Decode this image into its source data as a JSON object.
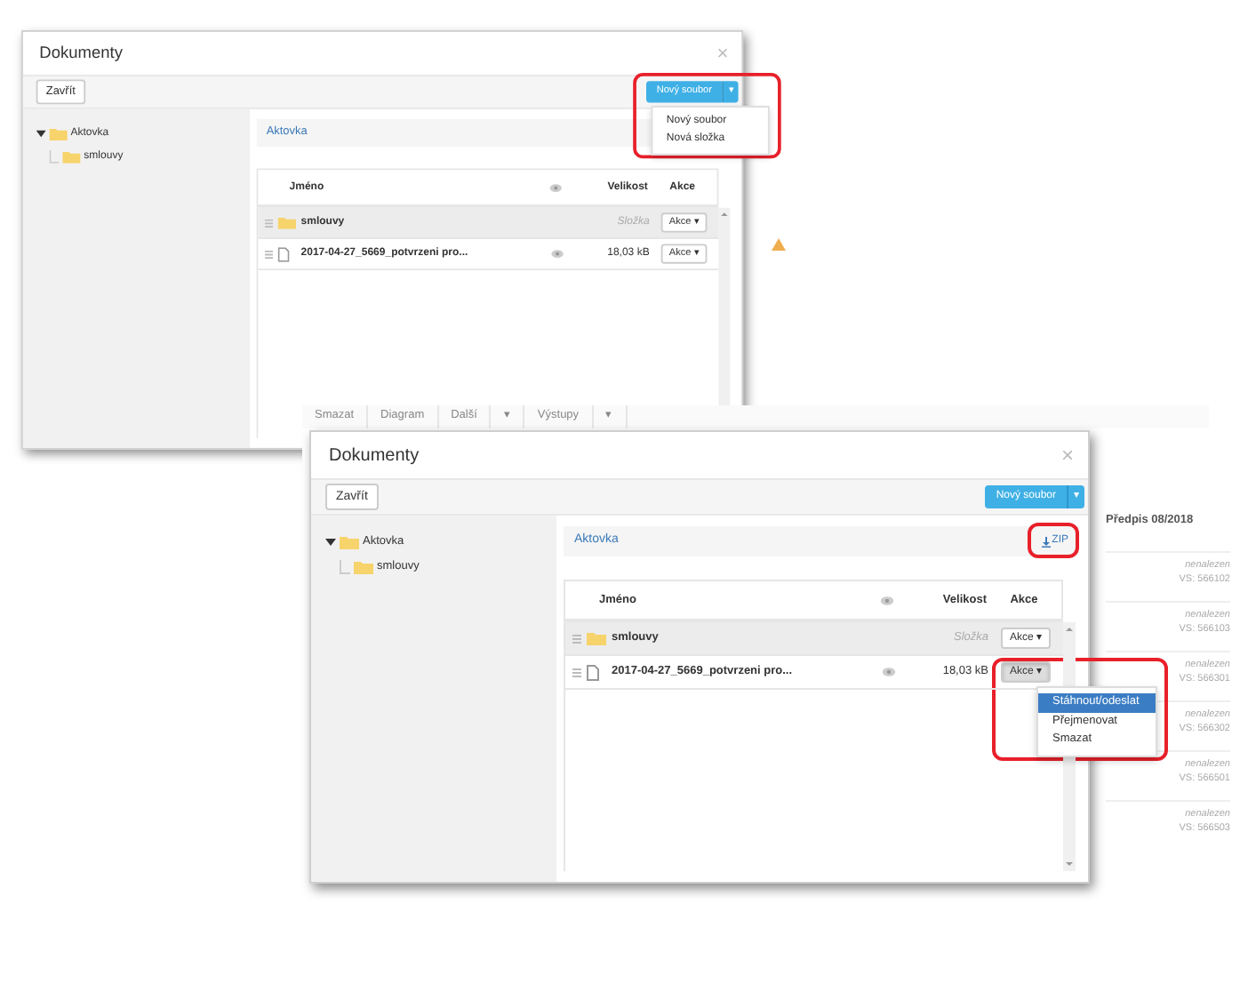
{
  "screens": [
    {
      "background": {
        "warning_shown": true
      },
      "dialog": {
        "title": "Dokumenty",
        "close": "×",
        "close_button": "Zavřít",
        "new_button": {
          "label": "Nový soubor",
          "caret": "▾",
          "highlighted": true,
          "menu": [
            {
              "label": "Nový soubor",
              "selected": false
            },
            {
              "label": "Nová složka",
              "selected": false
            }
          ]
        },
        "tree": [
          {
            "label": "Aktovka",
            "expanded": true,
            "children": [
              {
                "label": "smlouvy"
              }
            ]
          }
        ],
        "breadcrumb": "Aktovka",
        "table": {
          "columns": [
            "Jméno",
            "Velikost",
            "Akce"
          ],
          "rows": [
            {
              "kind": "folder",
              "name": "smlouvy",
              "size": "Složka",
              "action": "Akce",
              "caret": "▾",
              "hovered": true,
              "pressed": false
            },
            {
              "kind": "file",
              "name": "2017-04-27_5669_potvrzeni pro...",
              "size": "18,03 kB",
              "action": "Akce",
              "caret": "▾",
              "hovered": false,
              "pressed": false
            }
          ]
        }
      }
    },
    {
      "background": {
        "toolbar": [
          "Smazat",
          "Diagram",
          "Další",
          "▾",
          "Výstupy",
          "▾"
        ],
        "column_header": "Předpis 08/2018",
        "rows": [
          {
            "status": "nenalezen",
            "vs": "VS: 566102"
          },
          {
            "status": "nenalezen",
            "vs": "VS: 566103"
          },
          {
            "status": "nenalezen",
            "vs": "VS: 566301"
          },
          {
            "status": "nenalezen",
            "vs": "VS: 566302"
          },
          {
            "status": "nenalezen",
            "vs": "VS: 566501"
          },
          {
            "status": "nenalezen",
            "vs": "VS: 566503"
          }
        ]
      },
      "dialog": {
        "title": "Dokumenty",
        "close": "×",
        "close_button": "Zavřít",
        "new_button": {
          "label": "Nový soubor",
          "caret": "▾"
        },
        "tree": [
          {
            "label": "Aktovka",
            "expanded": true,
            "children": [
              {
                "label": "smlouvy"
              }
            ]
          }
        ],
        "breadcrumb": "Aktovka",
        "zip": {
          "label": "ZIP",
          "highlighted": true
        },
        "table": {
          "columns": [
            "Jméno",
            "Velikost",
            "Akce"
          ],
          "rows": [
            {
              "kind": "folder",
              "name": "smlouvy",
              "size": "Složka",
              "action": "Akce",
              "caret": "▾",
              "hovered": true,
              "pressed": false
            },
            {
              "kind": "file",
              "name": "2017-04-27_5669_potvrzeni pro...",
              "size": "18,03 kB",
              "action": "Akce",
              "caret": "▾",
              "hovered": false,
              "pressed": true,
              "action_menu": {
                "highlighted": true,
                "items": [
                  {
                    "label": "Stáhnout/odeslat",
                    "selected": true
                  },
                  {
                    "label": "Přejmenovat",
                    "selected": false
                  },
                  {
                    "label": "Smazat",
                    "selected": false
                  }
                ]
              }
            }
          ]
        }
      }
    }
  ]
}
